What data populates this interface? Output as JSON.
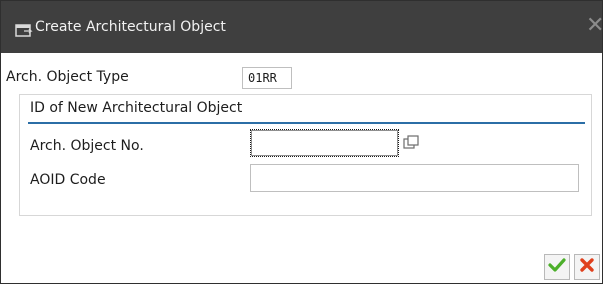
{
  "window": {
    "title": "Create Architectural Object",
    "close_glyph": "✕"
  },
  "form": {
    "object_type_label": "Arch. Object Type",
    "object_type_value": "01RR",
    "group_title": "ID of New Architectural Object",
    "object_no_label": "Arch. Object No.",
    "object_no_value": "",
    "aoid_label": "AOID Code",
    "aoid_value": ""
  },
  "footer": {
    "confirm_icon": "check-icon",
    "cancel_icon": "x-icon"
  },
  "colors": {
    "titlebar": "#3f3f3f",
    "accent_line": "#2b6ea6",
    "confirm": "#4caf2a",
    "cancel": "#e0401d"
  }
}
